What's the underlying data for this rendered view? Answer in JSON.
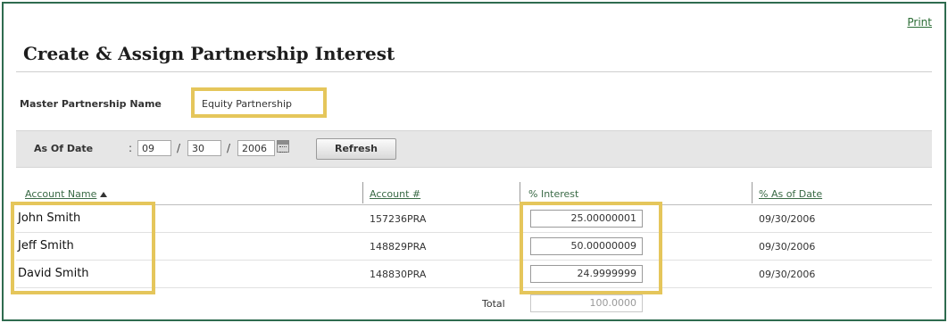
{
  "header": {
    "print_label": "Print",
    "title": "Create & Assign Partnership Interest"
  },
  "master": {
    "label": "Master Partnership Name",
    "value": "Equity Partnership"
  },
  "as_of": {
    "label": "As Of Date",
    "colon": ":",
    "month": "09",
    "day": "30",
    "year": "2006",
    "separator": "/",
    "refresh_label": "Refresh"
  },
  "table": {
    "columns": [
      "Account Name",
      "Account #",
      "% Interest",
      "% As of Date"
    ],
    "rows": [
      {
        "name": "John Smith",
        "account": "157236PRA",
        "interest": "25.00000001",
        "date": "09/30/2006"
      },
      {
        "name": "Jeff Smith",
        "account": "148829PRA",
        "interest": "50.00000009",
        "date": "09/30/2006"
      },
      {
        "name": "David Smith",
        "account": "148830PRA",
        "interest": "24.9999999",
        "date": "09/30/2006"
      }
    ],
    "total_label": "Total",
    "total_value": "100.0000"
  },
  "colors": {
    "highlight": "#e5c65b",
    "frame": "#2f6b4f",
    "link": "#3a6a46"
  }
}
